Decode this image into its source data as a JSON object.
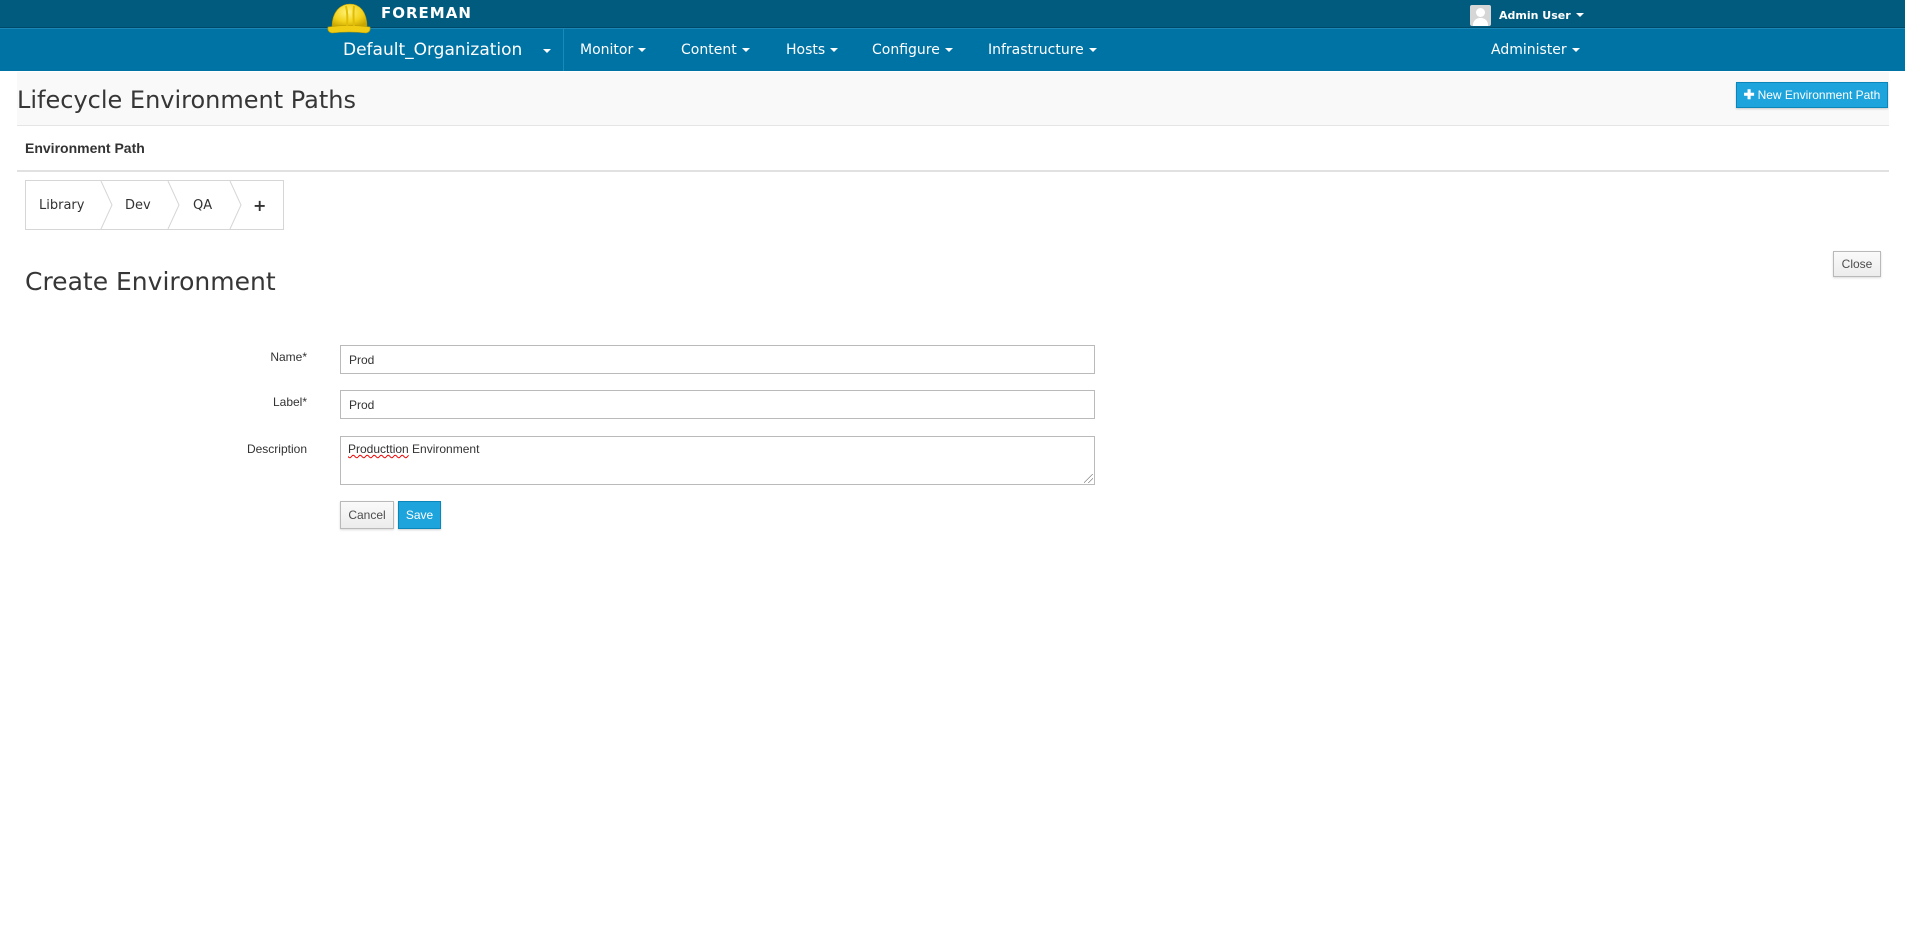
{
  "app": {
    "brand": "FOREMAN",
    "logo_icon": "hardhat-icon"
  },
  "user_menu": {
    "label": "Admin User",
    "avatar_icon": "user-avatar-icon"
  },
  "org_switcher": {
    "label": "Default_Organization"
  },
  "nav": {
    "items": [
      {
        "label": "Monitor"
      },
      {
        "label": "Content"
      },
      {
        "label": "Hosts"
      },
      {
        "label": "Configure"
      },
      {
        "label": "Infrastructure"
      }
    ],
    "right_items": [
      {
        "label": "Administer"
      }
    ]
  },
  "page": {
    "title": "Lifecycle Environment Paths",
    "new_button_label": "New Environment Path",
    "section_title": "Environment Path"
  },
  "path": {
    "items": [
      {
        "label": "Library"
      },
      {
        "label": "Dev"
      },
      {
        "label": "QA"
      }
    ],
    "add_label": "+"
  },
  "form": {
    "title": "Create Environment",
    "close_label": "Close",
    "fields": {
      "name": {
        "label": "Name*",
        "value": "Prod"
      },
      "label": {
        "label": "Label*",
        "value": "Prod"
      },
      "description": {
        "label": "Description",
        "value_misspelled_word": "Producttion",
        "value_rest": " Environment",
        "value": "Producttion Environment"
      }
    },
    "cancel_label": "Cancel",
    "save_label": "Save"
  },
  "colors": {
    "topbar": "#005b7f",
    "navbar": "#0073a5",
    "primary_button": "#1da4dc"
  }
}
